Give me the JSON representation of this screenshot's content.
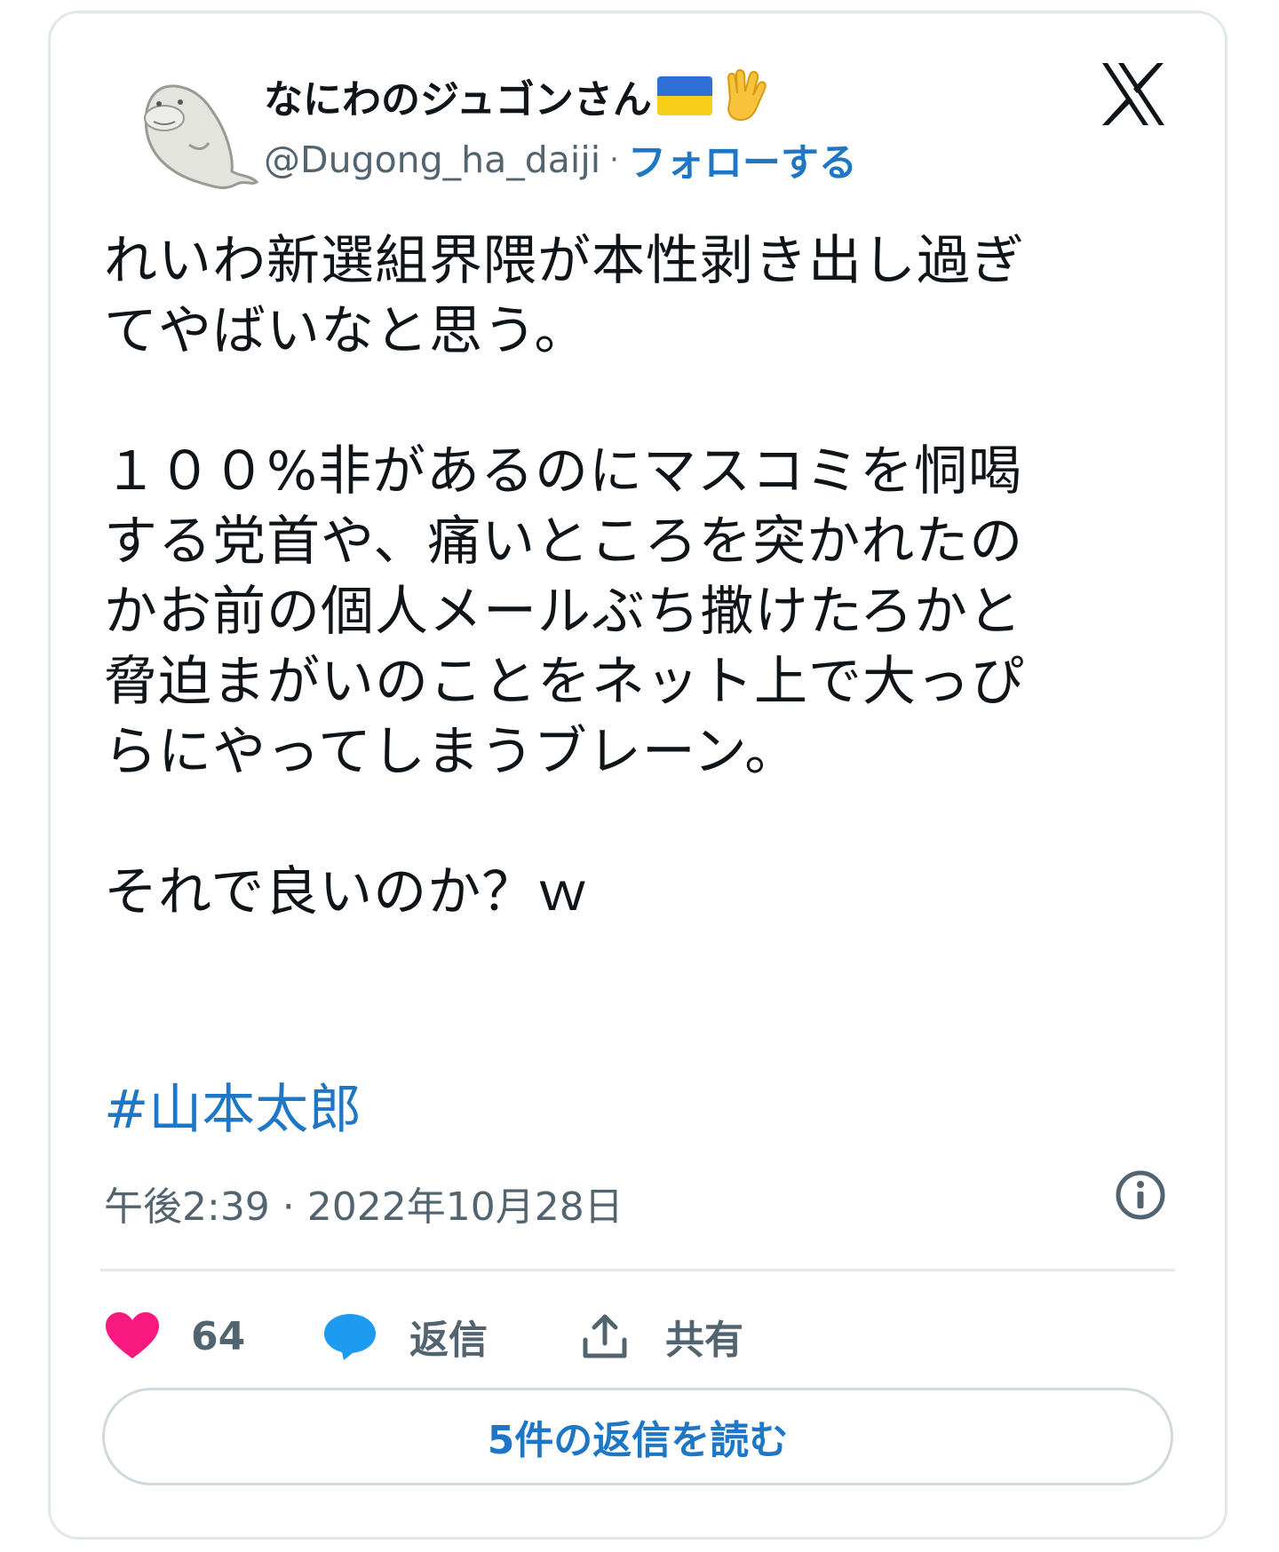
{
  "user": {
    "display_name": "なにわのジュゴンさん",
    "handle": "@Dugong_ha_daiji",
    "separator": "·",
    "follow_label": "フォローする",
    "flag_colors": [
      "#2f6fd6",
      "#f7cf1b"
    ]
  },
  "tweet": {
    "text": "れいわ新選組界隈が本性剥き出し過ぎ\nてやばいなと思う。\n\n１００%非があるのにマスコミを恫喝\nする党首や、痛いところを突かれたの\nかお前の個人メールぶち撒けたろかと\n脅迫まがいのことをネット上で大っぴ\nらにやってしまうブレーン。\n\nそれで良いのか？ｗ",
    "hashtag": "#山本太郎",
    "timestamp": "午後2:39 · 2022年10月28日"
  },
  "actions": {
    "like_count": "64",
    "reply_label": "返信",
    "share_label": "共有",
    "read_replies_label": "5件の返信を読む"
  },
  "colors": {
    "link": "#1d76c6",
    "like": "#f91880",
    "muted": "#536471",
    "border": "#e1e8ed"
  },
  "icons": [
    "dugong-avatar",
    "ukraine-flag-icon",
    "vulcan-salute-icon",
    "x-logo-icon",
    "info-icon",
    "heart-icon",
    "reply-bubble-icon",
    "share-icon"
  ]
}
